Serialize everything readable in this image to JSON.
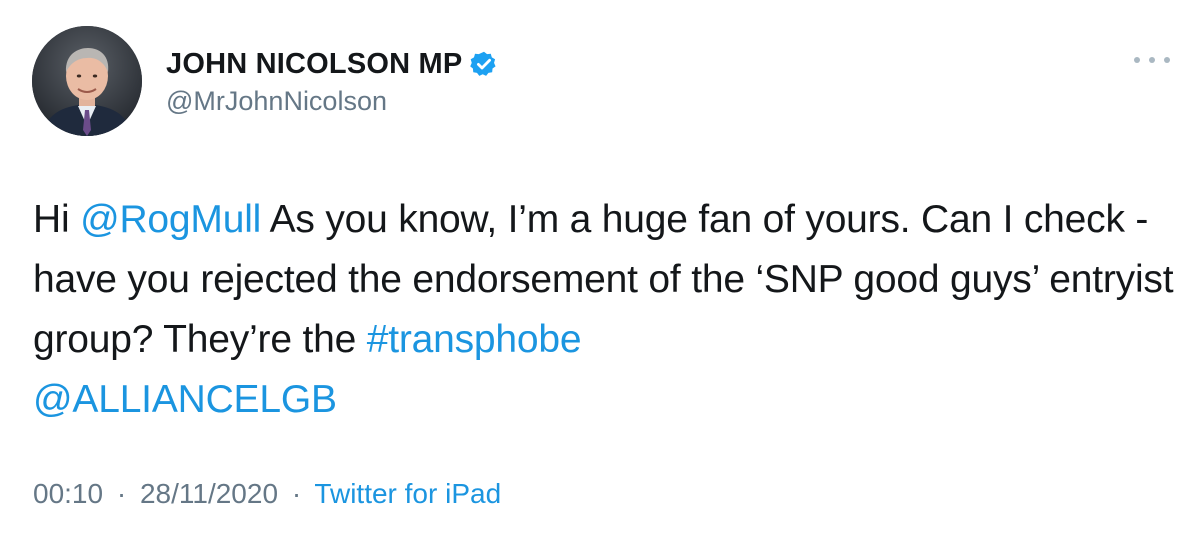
{
  "author": {
    "display_name": "JOHN NICOLSON MP",
    "handle": "@MrJohnNicolson",
    "verified": true,
    "avatar": "profile-photo-man-in-suit"
  },
  "more_icon": "ellipsis-icon",
  "tweet": {
    "segments": [
      {
        "text": "Hi ",
        "type": "text"
      },
      {
        "text": "@RogMull",
        "type": "mention"
      },
      {
        "text": " As you know, I’m a huge fan of yours. Can I check - have you rejected the endorsement of the ‘SNP good guys’ entryist group? They’re the ",
        "type": "text"
      },
      {
        "text": "#transphobe",
        "type": "hashtag"
      },
      {
        "text": " ",
        "type": "text"
      },
      {
        "text": "@ALLIANCELGB",
        "type": "mention"
      }
    ]
  },
  "meta": {
    "time": "00:10",
    "date": "28/11/2020",
    "separator": "·",
    "source": "Twitter for iPad"
  },
  "colors": {
    "link": "#1b95e0",
    "secondary_text": "#657786",
    "verified_badge": "#1da1f2"
  }
}
